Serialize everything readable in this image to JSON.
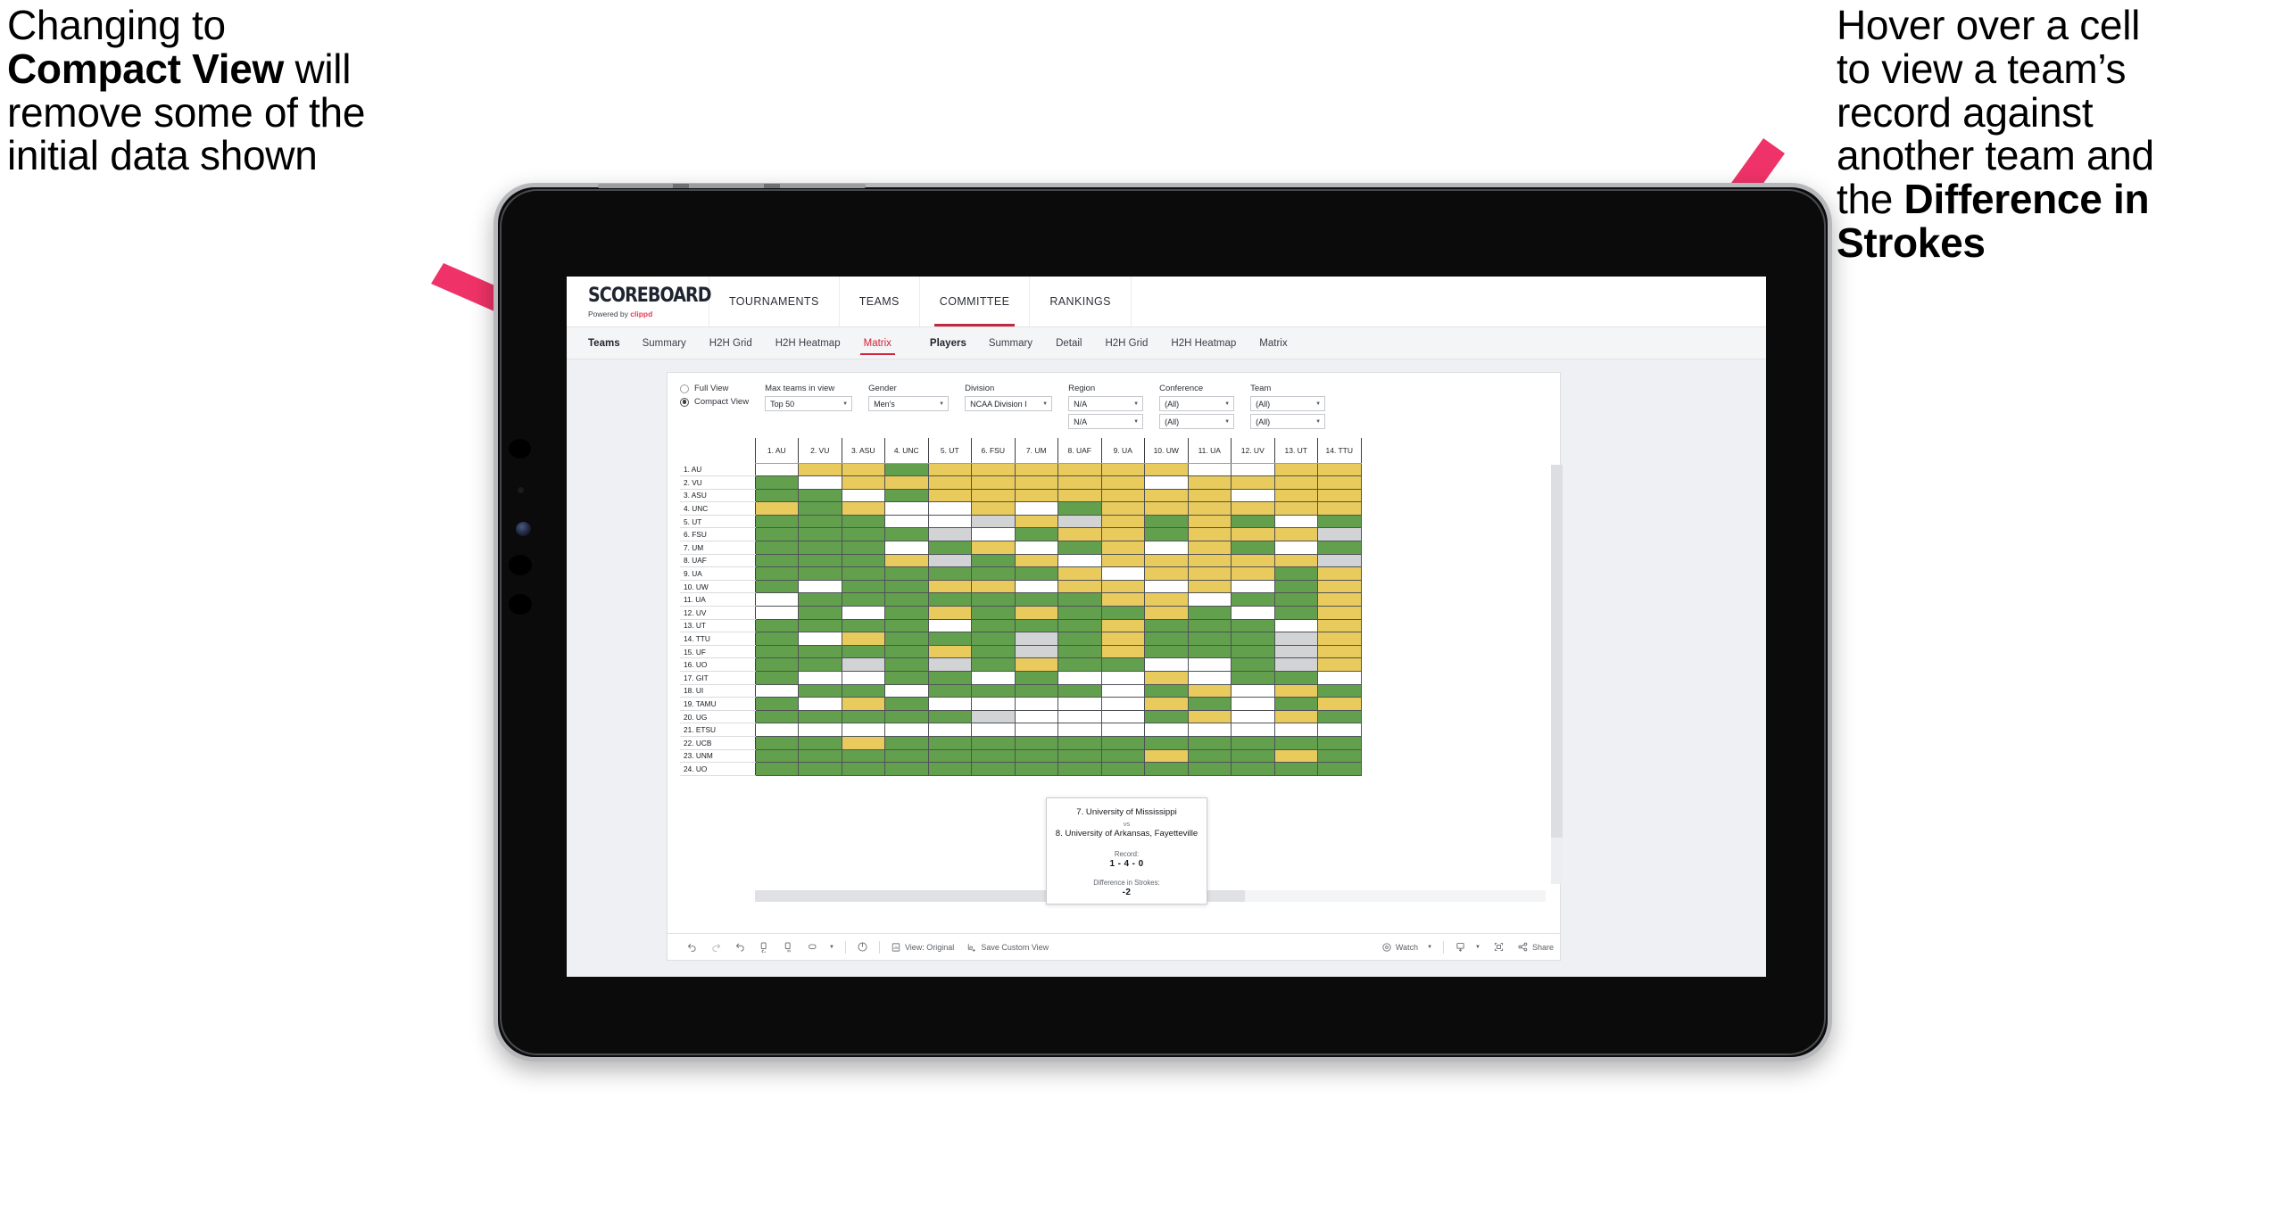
{
  "annotations": {
    "left": {
      "line1": "Changing to",
      "bold": "Compact View",
      "line2": " will",
      "line3": "remove some of the",
      "line4": "initial data shown"
    },
    "right": {
      "line1": "Hover over a cell",
      "line2": "to view a team’s",
      "line3": "record against",
      "line4": "another team and",
      "line5": "the ",
      "bold1": "Difference in",
      "bold2": "Strokes"
    },
    "arrow_color": "#ef3368"
  },
  "app": {
    "logo": {
      "main": "SCOREBOARD",
      "powered": "Powered by ",
      "brand": "clippd"
    },
    "topnav": [
      {
        "label": "TOURNAMENTS",
        "active": false
      },
      {
        "label": "TEAMS",
        "active": false
      },
      {
        "label": "COMMITTEE",
        "active": true
      },
      {
        "label": "RANKINGS",
        "active": false
      }
    ],
    "subnav": {
      "teams_head": "Teams",
      "teams_items": [
        {
          "label": "Summary",
          "active": false
        },
        {
          "label": "H2H Grid",
          "active": false
        },
        {
          "label": "H2H Heatmap",
          "active": false
        },
        {
          "label": "Matrix",
          "active": true
        }
      ],
      "players_head": "Players",
      "players_items": [
        {
          "label": "Summary",
          "active": false
        },
        {
          "label": "Detail",
          "active": false
        },
        {
          "label": "H2H Grid",
          "active": false
        },
        {
          "label": "H2H Heatmap",
          "active": false
        },
        {
          "label": "Matrix",
          "active": false
        }
      ]
    },
    "filters": {
      "view_mode": {
        "full": "Full View",
        "compact": "Compact View",
        "selected": "Compact View"
      },
      "max_teams": {
        "label": "Max teams in view",
        "value": "Top 50"
      },
      "gender": {
        "label": "Gender",
        "value": "Men's"
      },
      "division": {
        "label": "Division",
        "value": "NCAA Division I"
      },
      "region": {
        "label": "Region",
        "value1": "N/A",
        "value2": "N/A"
      },
      "conference": {
        "label": "Conference",
        "value1": "(All)",
        "value2": "(All)"
      },
      "team": {
        "label": "Team",
        "value1": "(All)",
        "value2": "(All)"
      }
    },
    "tooltip": {
      "team_a": "7. University of Mississippi",
      "vs": "vs",
      "team_b": "8. University of Arkansas, Fayetteville",
      "record_label": "Record:",
      "record_value": "1 - 4 - 0",
      "strokes_label": "Difference in Strokes:",
      "strokes_value": "-2"
    },
    "toolbar": {
      "view_original": "View: Original",
      "save_custom_view": "Save Custom View",
      "watch": "Watch",
      "share": "Share"
    }
  },
  "chart_data": {
    "type": "heatmap",
    "title": "Team Head-to-Head Matrix",
    "legend": {
      "win": "#62a04e",
      "loss": "#e8cb5c",
      "tie": "#d2d3d5",
      "none": "#ffffff"
    },
    "columns": [
      "1. AU",
      "2. VU",
      "3. ASU",
      "4. UNC",
      "5. UT",
      "6. FSU",
      "7. UM",
      "8. UAF",
      "9. UA",
      "10. UW",
      "11. UA",
      "12. UV",
      "13. UT",
      "14. TTU"
    ],
    "rows": [
      "1. AU",
      "2. VU",
      "3. ASU",
      "4. UNC",
      "5. UT",
      "6. FSU",
      "7. UM",
      "8. UAF",
      "9. UA",
      "10. UW",
      "11. UA",
      "12. UV",
      "13. UT",
      "14. TTU",
      "15. UF",
      "16. UO",
      "17. GIT",
      "18. UI",
      "19. TAMU",
      "20. UG",
      "21. ETSU",
      "22. UCB",
      "23. UNM",
      "24. UO"
    ],
    "cells": [
      [
        "w",
        "y",
        "y",
        "g",
        "y",
        "y",
        "y",
        "y",
        "y",
        "y",
        "w",
        "w",
        "y",
        "y"
      ],
      [
        "g",
        "w",
        "y",
        "y",
        "y",
        "y",
        "y",
        "y",
        "y",
        "w",
        "y",
        "y",
        "y",
        "y"
      ],
      [
        "g",
        "g",
        "w",
        "g",
        "y",
        "y",
        "y",
        "y",
        "y",
        "y",
        "y",
        "w",
        "y",
        "y"
      ],
      [
        "y",
        "g",
        "y",
        "w",
        "w",
        "y",
        "w",
        "g",
        "y",
        "y",
        "y",
        "y",
        "y",
        "y"
      ],
      [
        "g",
        "g",
        "g",
        "w",
        "w",
        "a",
        "y",
        "a",
        "y",
        "g",
        "y",
        "g",
        "w",
        "g"
      ],
      [
        "g",
        "g",
        "g",
        "g",
        "a",
        "w",
        "g",
        "y",
        "y",
        "g",
        "y",
        "y",
        "y",
        "a"
      ],
      [
        "g",
        "g",
        "g",
        "w",
        "g",
        "y",
        "w",
        "g",
        "y",
        "w",
        "y",
        "g",
        "w",
        "g"
      ],
      [
        "g",
        "g",
        "g",
        "y",
        "a",
        "g",
        "y",
        "w",
        "y",
        "y",
        "y",
        "y",
        "y",
        "a"
      ],
      [
        "g",
        "g",
        "g",
        "g",
        "g",
        "g",
        "g",
        "y",
        "w",
        "y",
        "y",
        "y",
        "g",
        "y"
      ],
      [
        "g",
        "w",
        "g",
        "g",
        "y",
        "y",
        "w",
        "y",
        "y",
        "w",
        "y",
        "w",
        "g",
        "y"
      ],
      [
        "w",
        "g",
        "g",
        "g",
        "g",
        "g",
        "g",
        "g",
        "y",
        "y",
        "w",
        "g",
        "g",
        "y"
      ],
      [
        "w",
        "g",
        "w",
        "g",
        "y",
        "g",
        "y",
        "g",
        "g",
        "y",
        "g",
        "w",
        "g",
        "y"
      ],
      [
        "g",
        "g",
        "g",
        "g",
        "w",
        "g",
        "g",
        "g",
        "y",
        "g",
        "g",
        "g",
        "w",
        "y"
      ],
      [
        "g",
        "w",
        "y",
        "g",
        "g",
        "g",
        "a",
        "g",
        "y",
        "g",
        "g",
        "g",
        "a",
        "y"
      ],
      [
        "g",
        "g",
        "g",
        "g",
        "y",
        "g",
        "a",
        "g",
        "y",
        "g",
        "g",
        "g",
        "a",
        "y"
      ],
      [
        "g",
        "g",
        "a",
        "g",
        "a",
        "g",
        "y",
        "g",
        "g",
        "w",
        "w",
        "g",
        "a",
        "y"
      ],
      [
        "g",
        "w",
        "w",
        "g",
        "g",
        "w",
        "g",
        "w",
        "w",
        "y",
        "w",
        "g",
        "g",
        "w"
      ],
      [
        "w",
        "g",
        "g",
        "w",
        "g",
        "g",
        "g",
        "g",
        "w",
        "g",
        "y",
        "w",
        "y",
        "g"
      ],
      [
        "g",
        "w",
        "y",
        "g",
        "w",
        "w",
        "w",
        "w",
        "w",
        "y",
        "g",
        "w",
        "g",
        "y"
      ],
      [
        "g",
        "g",
        "g",
        "g",
        "g",
        "a",
        "w",
        "w",
        "w",
        "g",
        "y",
        "w",
        "y",
        "g"
      ],
      [
        "w",
        "w",
        "w",
        "w",
        "w",
        "w",
        "w",
        "w",
        "w",
        "w",
        "w",
        "w",
        "w",
        "w"
      ],
      [
        "g",
        "g",
        "y",
        "g",
        "g",
        "g",
        "g",
        "g",
        "g",
        "g",
        "g",
        "g",
        "g",
        "g"
      ],
      [
        "g",
        "g",
        "g",
        "g",
        "g",
        "g",
        "g",
        "g",
        "g",
        "y",
        "g",
        "g",
        "y",
        "g"
      ],
      [
        "g",
        "g",
        "g",
        "g",
        "g",
        "g",
        "g",
        "g",
        "g",
        "g",
        "g",
        "g",
        "g",
        "g"
      ]
    ]
  }
}
